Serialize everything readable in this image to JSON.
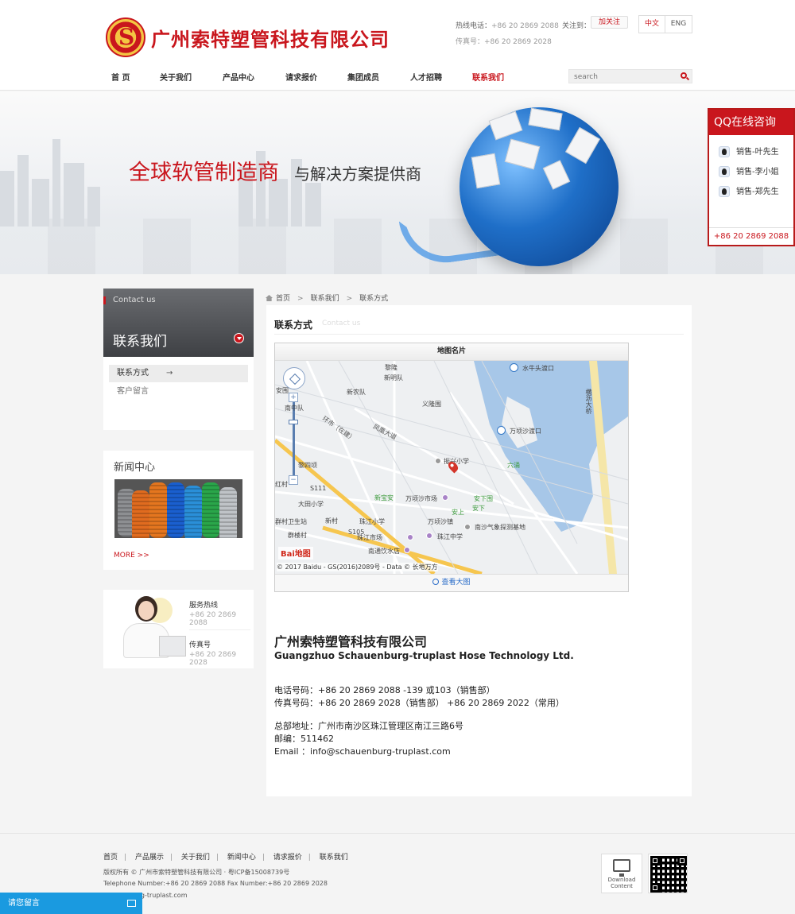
{
  "header": {
    "logo_emblem_letter": "S",
    "company_name": "广州索特塑管科技有限公司",
    "hotline_label": "热线电话：",
    "hotline": "+86 20 2869 2088",
    "fax_label": "传真号：",
    "fax": "+86 20 2869 2028",
    "follow_label": "关注到：",
    "weibo_label": "加关注",
    "lang_cn": "中文",
    "lang_en": "ENG"
  },
  "nav": {
    "items": [
      "首 页",
      "关于我们",
      "产品中心",
      "请求报价",
      "集团成员",
      "人才招聘",
      "联系我们"
    ],
    "active_index": 6,
    "search_placeholder": "search"
  },
  "banner": {
    "headline_red": "全球软管制造商",
    "headline_dark": "与解决方案提供商"
  },
  "qq_panel": {
    "title": "QQ在线咨询",
    "contacts": [
      "销售-叶先生",
      "销售-李小姐",
      "销售-郑先生"
    ],
    "phone": "+86 20 2869 2088"
  },
  "sidebar": {
    "contact_en": "Contact us",
    "contact_cn": "联系我们",
    "items": [
      {
        "label": "联系方式",
        "arrow": "→"
      },
      {
        "label": "客户留言"
      }
    ],
    "news_title": "新闻中心",
    "more_label": "MORE >>",
    "service_label": "服务热线",
    "service_phone": "+86 20 2869 2088",
    "fax_label": "传真号",
    "fax": "+86 20 2869 2028"
  },
  "breadcrumb": {
    "items": [
      "首页",
      "联系我们",
      "联系方式"
    ],
    "separator": ">"
  },
  "content": {
    "title": "联系方式",
    "subtitle": "Contact us",
    "map": {
      "card_title": "地图名片",
      "view_larger": "查看大图",
      "logo": "Bai地图",
      "copyright": "© 2017 Baidu - GS(2016)2089号 - Data © 长地万方",
      "labels": {
        "l1": "黎隆",
        "l2": "新明队",
        "l3": "水牛头渡口",
        "l4": "安围",
        "l5": "新农队",
        "l6": "义隆围",
        "l7": "南中队",
        "l8": "凤凰大道",
        "l9": "万顷沙渡口",
        "l10": "横沥大桥",
        "l11": "黎四顷",
        "l12": "振兴小学",
        "l13": "六涌",
        "l14": "环市（在建）",
        "l15": "新宝安",
        "l16": "万顷沙市场",
        "l17": "安下围",
        "l18": "大田小学",
        "l19": "安上",
        "l20": "安下",
        "l21": "珠江小学",
        "l22": "万顷沙镇",
        "l23": "南沙气象探测基地",
        "l24": "群村卫生站",
        "l25": "新村",
        "l26": "群楼村",
        "l27": "珠江市场",
        "l28": "珠江中学",
        "l29": "南通饮水店",
        "l30": "红村",
        "l31": "S105",
        "l32": "S111"
      }
    },
    "company_cn": "广州索特塑管科技有限公司",
    "company_en": "Guangzhuo Schauenburg-truplast Hose Technology Ltd.",
    "phone_line": "电话号码：+86 20 2869 2088 -139 或103（销售部）",
    "fax_line": "传真号码：+86 20 2869 2028（销售部） +86 20 2869 2022（常用）",
    "address_line": "总部地址：广州市南沙区珠江管理区南江三路6号",
    "zip_line": "邮编：511462",
    "email_line": "Email ：info@schauenburg-truplast.com"
  },
  "footer": {
    "links": [
      "首页",
      "产品展示",
      "关于我们",
      "新闻中心",
      "请求报价",
      "联系我们"
    ],
    "separator": "|",
    "copyright": "版权所有 © 广州市索特塑管科技有限公司 · 粤ICP备15008739号",
    "tel_fax": "Telephone Number:+86 20 2869 2088 Fax Number:+86 20 2869 2028",
    "website": "schauenburg-truplast.com",
    "download_label_1": "Download",
    "download_label_2": "Content"
  },
  "message_bar": {
    "label": "请您留言"
  }
}
